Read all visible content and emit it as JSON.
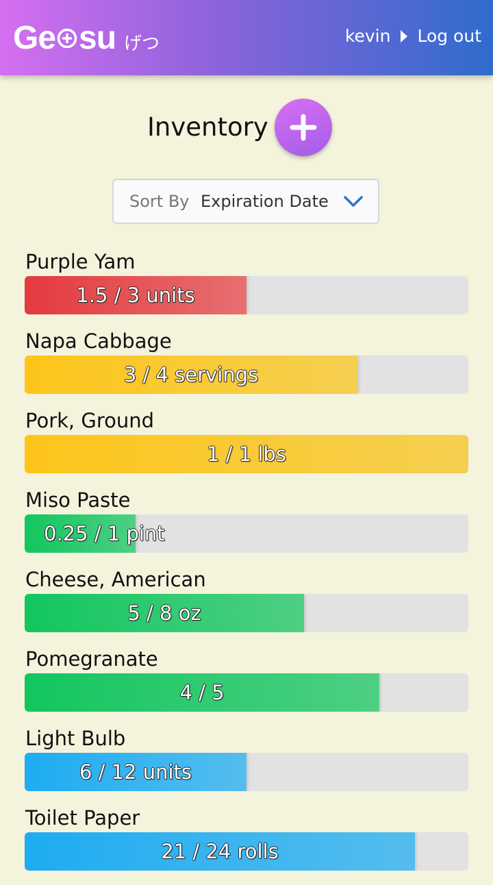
{
  "header": {
    "logo_left": "Ge",
    "logo_right": "su",
    "logo_jp": "げつ",
    "username": "kevin",
    "logout_label": "Log out",
    "gradient_colors": [
      "#d56ff0",
      "#8a63db",
      "#2f6ccd"
    ]
  },
  "main": {
    "title": "Inventory",
    "add_icon": "plus-icon",
    "sort": {
      "label": "Sort By",
      "selected": "Expiration Date",
      "icon": "chevron-down-icon"
    }
  },
  "items": [
    {
      "name": "Purple Yam",
      "amount": "1.5 / 3 units",
      "fraction": 0.5,
      "status": "red"
    },
    {
      "name": "Napa Cabbage",
      "amount": "3 / 4 servings",
      "fraction": 0.75,
      "status": "yellow"
    },
    {
      "name": "Pork, Ground",
      "amount": "1 / 1 lbs",
      "fraction": 1.0,
      "status": "yellow"
    },
    {
      "name": "Miso Paste",
      "amount": "0.25 / 1 pint",
      "fraction": 0.25,
      "status": "green"
    },
    {
      "name": "Cheese, American",
      "amount": "5 / 8 oz",
      "fraction": 0.63,
      "status": "green"
    },
    {
      "name": "Pomegranate",
      "amount": "4 / 5",
      "fraction": 0.8,
      "status": "green"
    },
    {
      "name": "Light Bulb",
      "amount": "6 / 12 units",
      "fraction": 0.5,
      "status": "blue"
    },
    {
      "name": "Toilet Paper",
      "amount": "21 / 24 rolls",
      "fraction": 0.88,
      "status": "blue"
    }
  ],
  "status_colors": {
    "red": "#e43a3f",
    "yellow": "#fdc51a",
    "green": "#12c65e",
    "blue": "#1eacf2"
  }
}
